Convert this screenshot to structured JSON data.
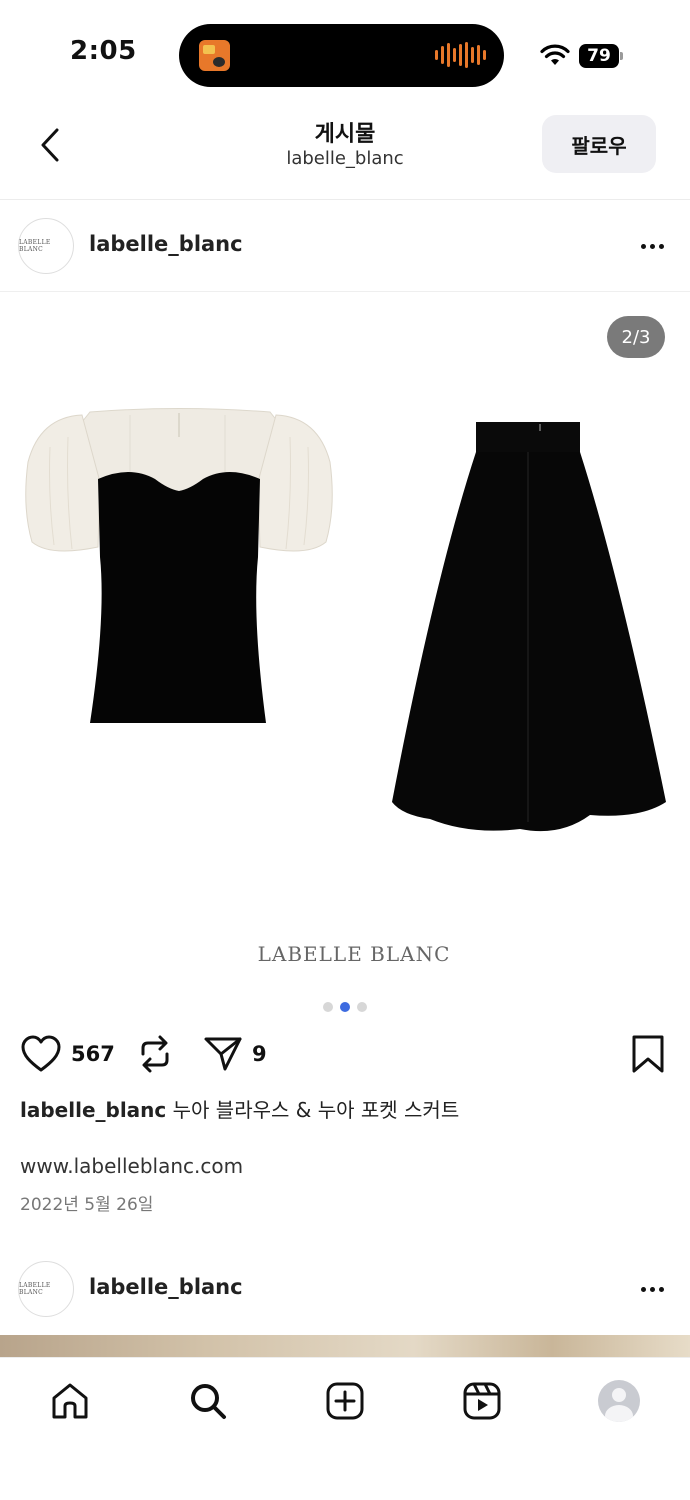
{
  "status_bar": {
    "time": "2:05",
    "battery": "79"
  },
  "header": {
    "title": "게시물",
    "subtitle": "labelle_blanc",
    "follow_label": "팔로우"
  },
  "post": {
    "avatar_text": "LABELLE BLANC",
    "username": "labelle_blanc",
    "image_counter": "2/3",
    "brand_watermark": "LABELLE BLANC",
    "carousel_total": 3,
    "carousel_active": 2,
    "like_count": "567",
    "share_count": "9",
    "caption_user": "labelle_blanc",
    "caption_text": " 누아 블라우스 & 누아 포켓 스커트",
    "link": "www.labelleblanc.com",
    "date": "2022년 5월 26일"
  },
  "next_post": {
    "avatar_text": "LABELLE BLANC",
    "username": "labelle_blanc"
  },
  "tabs": [
    "home-icon",
    "search-icon",
    "create-icon",
    "reels-icon",
    "profile-avatar"
  ],
  "colors": {
    "accent_dot": "#3d6be0",
    "follow_bg": "#efeff3"
  }
}
